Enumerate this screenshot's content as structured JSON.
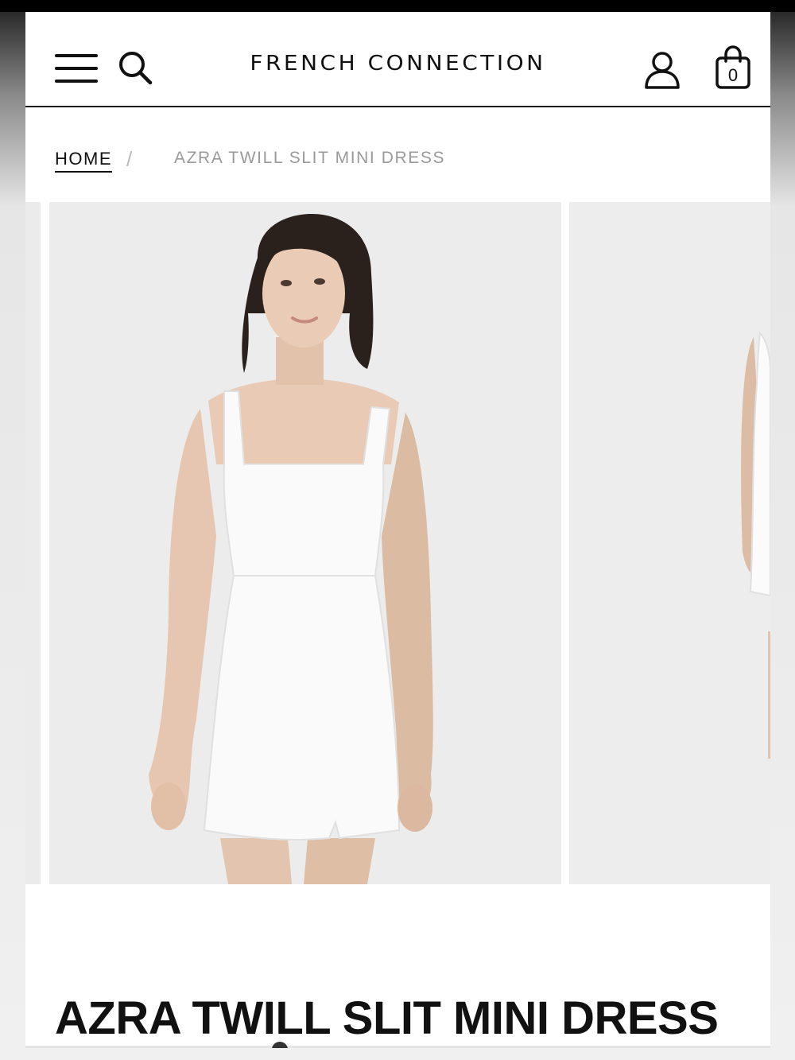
{
  "header": {
    "brand": "FRENCH CONNECTION",
    "menu_icon": "hamburger-menu-icon",
    "search_icon": "search-icon",
    "account_icon": "user-account-icon",
    "bag_icon": "shopping-bag-icon",
    "bag_count": "0"
  },
  "breadcrumb": {
    "home": "HOME",
    "separator": "/",
    "current": "AZRA TWILL SLIT MINI DRESS"
  },
  "gallery": {
    "images": [
      "model-front-view",
      "model-side-view"
    ]
  },
  "product": {
    "title": "AZRA TWILL SLIT MINI DRESS"
  },
  "colors": {
    "text": "#111111",
    "muted": "#9a9a9a",
    "image_bg": "#ececec"
  }
}
